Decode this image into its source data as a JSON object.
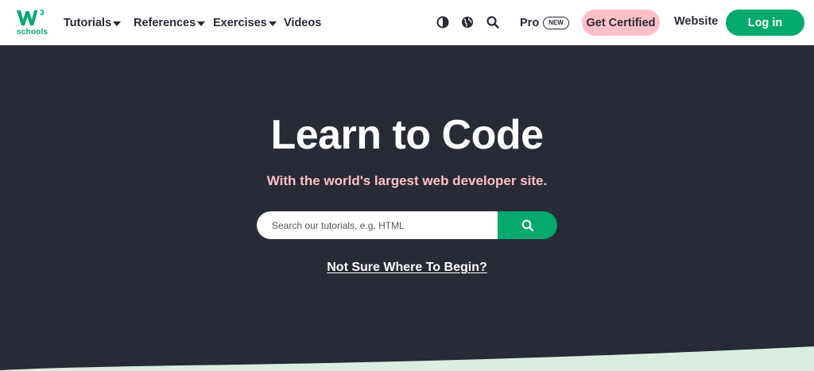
{
  "brand": {
    "logo_text": "schools",
    "color": "#04aa6d"
  },
  "nav": {
    "tutorials": "Tutorials",
    "references": "References",
    "exercises": "Exercises",
    "videos": "Videos",
    "pro": "Pro",
    "new_badge": "NEW",
    "get_certified": "Get Certified",
    "website": "Website",
    "login": "Log in"
  },
  "icons": {
    "contrast": "contrast-icon",
    "globe": "globe-icon",
    "search": "search-icon"
  },
  "hero": {
    "title": "Learn to Code",
    "subtitle": "With the world's largest web developer site.",
    "search_placeholder": "Search our tutorials, e.g. HTML",
    "search_value": "",
    "not_sure": "Not Sure Where To Begin?"
  },
  "colors": {
    "background": "#282a35",
    "accent_green": "#04aa6d",
    "accent_pink": "#ffc0c7",
    "wave": "#d9eee1"
  }
}
